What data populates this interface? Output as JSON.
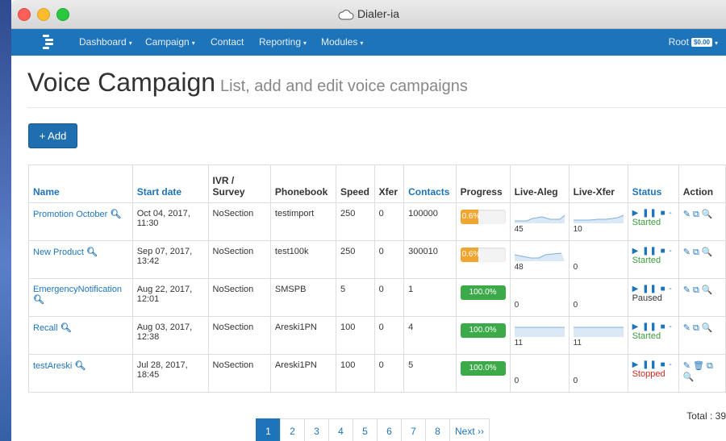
{
  "window": {
    "title": "Dialer-ia"
  },
  "nav": {
    "items": [
      {
        "label": "Dashboard",
        "caret": "▾"
      },
      {
        "label": "Campaign",
        "caret": "▾"
      },
      {
        "label": "Contact",
        "caret": ""
      },
      {
        "label": "Reporting",
        "caret": "▾"
      },
      {
        "label": "Modules",
        "caret": "▾"
      }
    ],
    "user": "Root",
    "balance": "$0.00",
    "user_caret": "▾"
  },
  "page": {
    "title": "Voice Campaign",
    "subtitle": "List, add and edit voice campaigns",
    "add_label": "+ Add"
  },
  "table": {
    "headers": {
      "name": "Name",
      "start_date": "Start date",
      "ivr": "IVR / Survey",
      "phonebook": "Phonebook",
      "speed": "Speed",
      "xfer": "Xfer",
      "contacts": "Contacts",
      "progress": "Progress",
      "live_aleg": "Live-Aleg",
      "live_xfer": "Live-Xfer",
      "status": "Status",
      "action": "Action"
    },
    "rows": [
      {
        "name": "Promotion October",
        "start": "Oct 04, 2017, 11:30",
        "ivr": "NoSection",
        "phonebook": "testimport",
        "speed": "250",
        "xfer": "0",
        "contacts": "100000",
        "progress": "0.6%",
        "progress_value": 0.6,
        "aleg": "45",
        "xferlive": "10",
        "controls": "▶ ❚❚ ■ -",
        "status": "Started",
        "actions": "✎ ⧉ 🔍"
      },
      {
        "name": "New Product",
        "start": "Sep 07, 2017, 13:42",
        "ivr": "NoSection",
        "phonebook": "test100k",
        "speed": "250",
        "xfer": "0",
        "contacts": "300010",
        "progress": "0.6%",
        "progress_value": 0.6,
        "aleg": "48",
        "xferlive": "0",
        "controls": "▶ ❚❚ ■ -",
        "status": "Started",
        "actions": "✎ ⧉ 🔍"
      },
      {
        "name": "EmergencyNotification",
        "start": "Aug 22, 2017, 12:01",
        "ivr": "NoSection",
        "phonebook": "SMSPB",
        "speed": "5",
        "xfer": "0",
        "contacts": "1",
        "progress": "100.0%",
        "progress_value": 100,
        "aleg": "0",
        "xferlive": "0",
        "controls": "▶ ❚❚ ■ -",
        "status": "Paused",
        "actions": "✎ ⧉ 🔍"
      },
      {
        "name": "Recall",
        "start": "Aug 03, 2017, 12:38",
        "ivr": "NoSection",
        "phonebook": "Areski1PN",
        "speed": "100",
        "xfer": "0",
        "contacts": "4",
        "progress": "100.0%",
        "progress_value": 100,
        "aleg": "11",
        "xferlive": "11",
        "controls": "▶ ❚❚ ■ -",
        "status": "Started",
        "actions": "✎ ⧉ 🔍"
      },
      {
        "name": "testAreski",
        "start": "Jul 28, 2017, 18:45",
        "ivr": "NoSection",
        "phonebook": "Areski1PN",
        "speed": "100",
        "xfer": "0",
        "contacts": "5",
        "progress": "100.0%",
        "progress_value": 100,
        "aleg": "0",
        "xferlive": "0",
        "controls": "▶ ❚❚ ■ -",
        "status": "Stopped",
        "actions": "✎ 🗑 ⧉ 🔍"
      }
    ]
  },
  "footer": {
    "total": "Total : 39",
    "pages": [
      "1",
      "2",
      "3",
      "4",
      "5",
      "6",
      "7",
      "8"
    ],
    "next": "Next ››"
  },
  "colors": {
    "nav": "#1e74b8",
    "progress_low": "#f0a531",
    "progress_full": "#3daa4a",
    "started": "#3c9a3c",
    "stopped": "#d9261c"
  }
}
